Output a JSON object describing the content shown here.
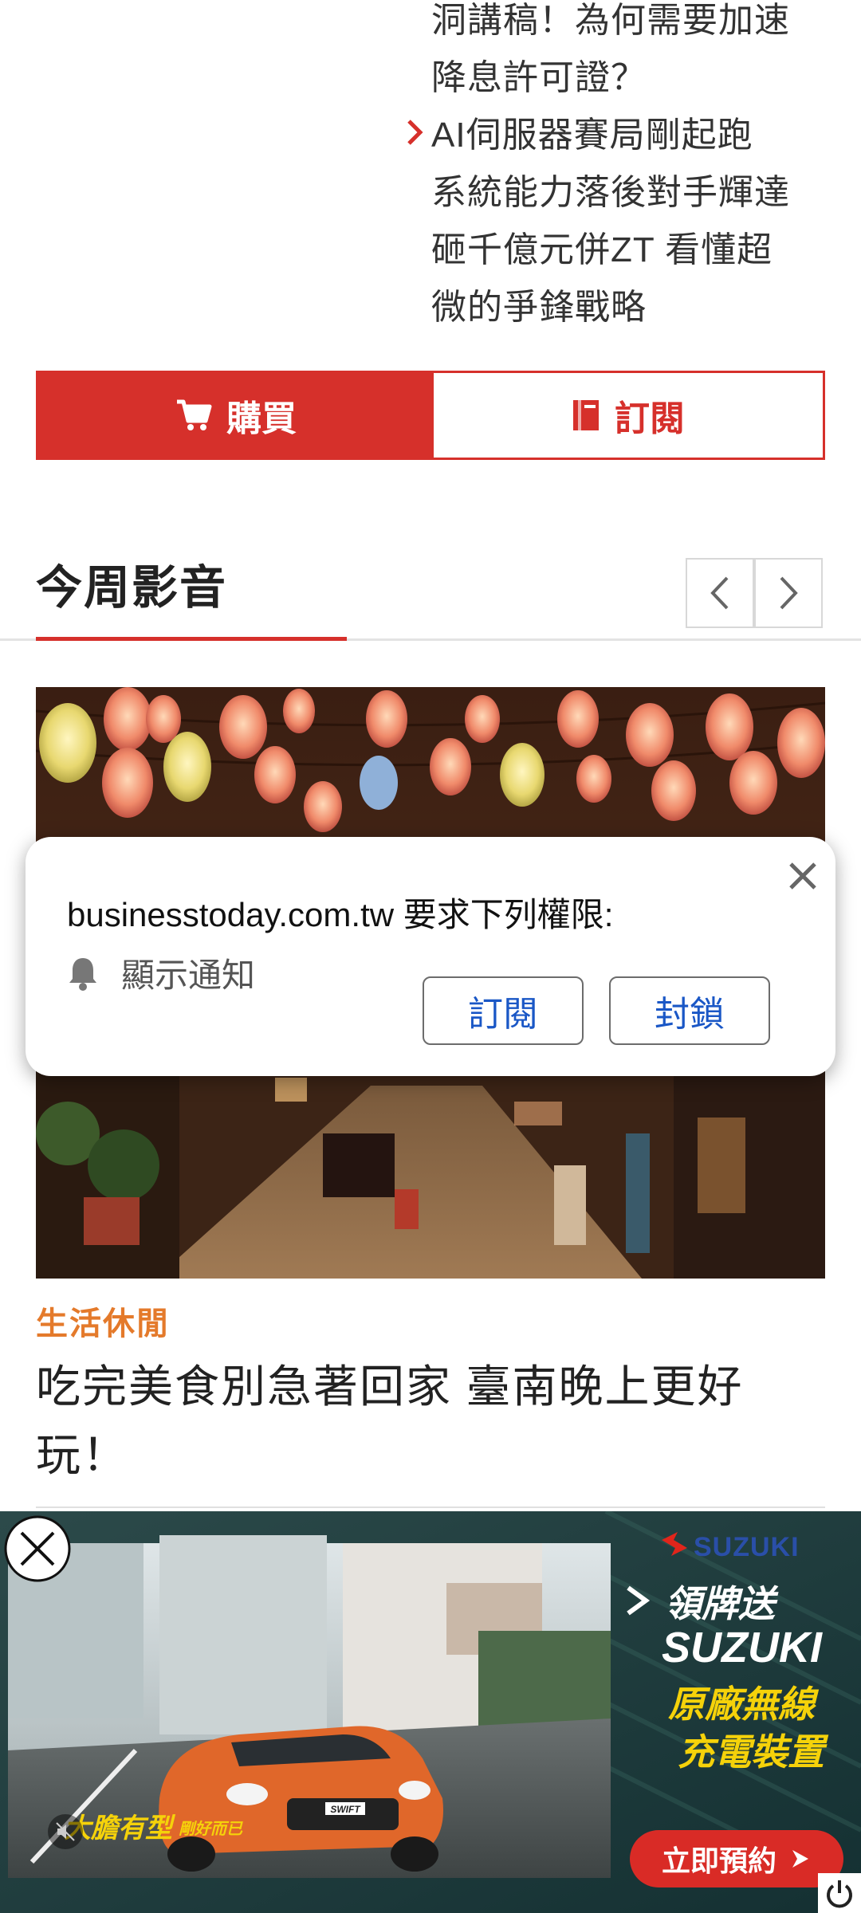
{
  "top_articles": {
    "lines": [
      "洞講稿！為何需要加速",
      "降息許可證？",
      "AI伺服器賽局剛起跑",
      "系統能力落後對手輝達",
      "砸千億元併ZT 看懂超",
      "微的爭鋒戰略"
    ]
  },
  "actions": {
    "buy_label": "購買",
    "subscribe_label": "訂閱"
  },
  "section": {
    "title": "今周影音"
  },
  "video": {
    "category": "生活休閒",
    "headline": "吃完美食別急著回家 臺南晚上更好玩！"
  },
  "permission_dialog": {
    "message": "businesstoday.com.tw 要求下列權限:",
    "permission": "顯示通知",
    "allow_label": "訂閱",
    "block_label": "封鎖"
  },
  "ad": {
    "brand": "SUZUKI",
    "promo_line1": "領牌送",
    "promo_line2": "SUZUKI",
    "promo_line3": "原廠無線",
    "promo_line4": "充電裝置",
    "tagline": "大膽有型",
    "tagline_small": "剛好而已",
    "car_badge": "SWIFT",
    "cta": "立即預約",
    "colors": {
      "cta": "#d92b26",
      "promo_yellow": "#f5d20a"
    }
  },
  "colors": {
    "accent": "#d6302b",
    "category": "#e47a2b",
    "dialog_button_text": "#1a57c6"
  }
}
